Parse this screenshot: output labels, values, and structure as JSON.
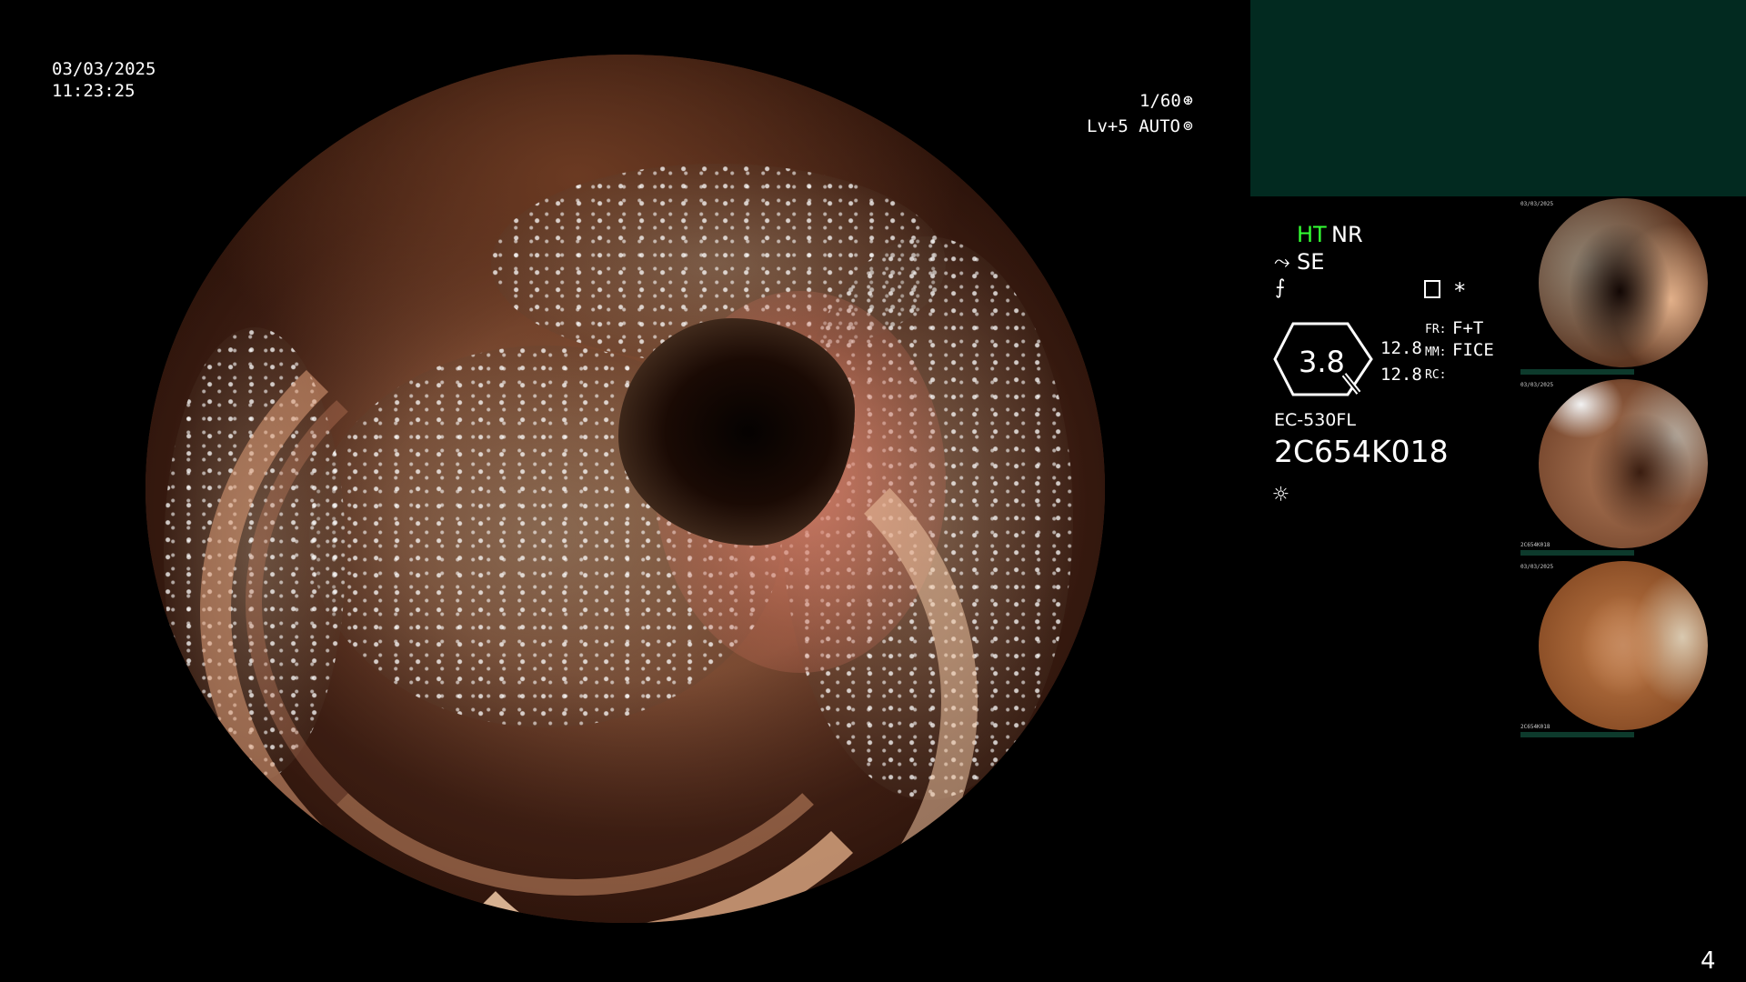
{
  "overlay": {
    "date": "03/03/2025",
    "time": "11:23:25",
    "shutter": "1/60",
    "level": "Lv+5 AUTO",
    "page_number": "4"
  },
  "side": {
    "ht": "HT",
    "nr": "NR",
    "se": "SE",
    "gauge_value": "3.8",
    "val_top": "12.8",
    "val_bottom": "12.8",
    "fr_label": "FR:",
    "fr_value": "F+T",
    "mm_label": "MM:",
    "mm_value": "FICE",
    "rc_label": "RC:",
    "model": "EC-530FL",
    "serial": "2C654K018"
  },
  "thumbnails": [
    {
      "mini_top": "03/03/2025",
      "mini_bottom": ""
    },
    {
      "mini_top": "03/03/2025",
      "mini_bottom": "2C654K018"
    },
    {
      "mini_top": "03/03/2025",
      "mini_bottom": "2C654K018"
    }
  ],
  "colors": {
    "ht_green": "#33ff33",
    "panel_green": "#022a20"
  }
}
